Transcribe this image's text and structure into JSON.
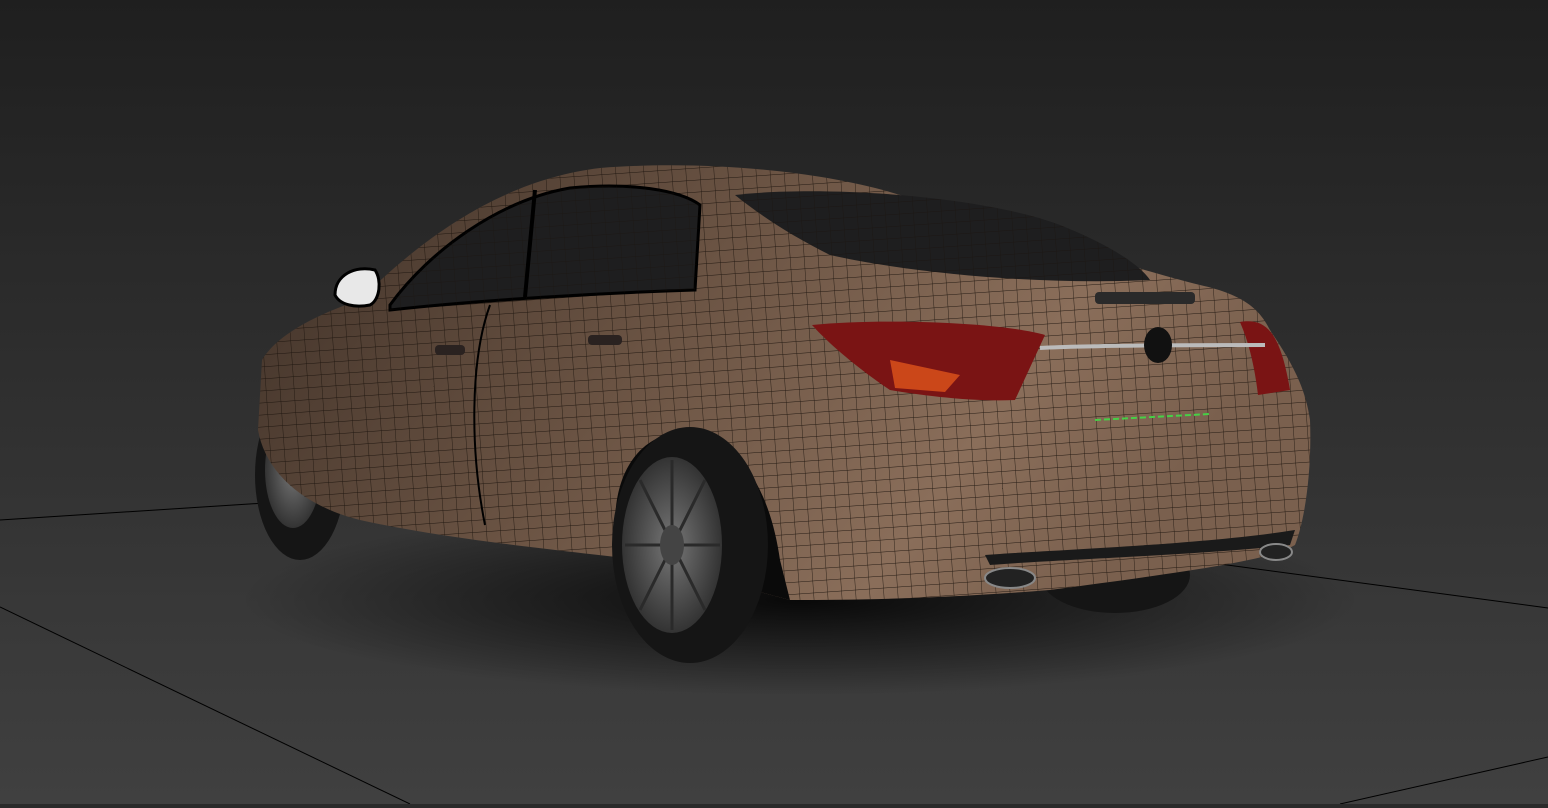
{
  "viewport": {
    "mode": "shaded-wireframe",
    "colors": {
      "background_top": "#1f1f1f",
      "background_bottom": "#404040",
      "ground_line": "#000000",
      "body_paint": "#6e5646",
      "body_highlight": "#8a6e5a",
      "wire": "#1a120c",
      "glass": "#1e1e1f",
      "tail_light": "#9a1a18",
      "tail_light_inner": "#e0541a",
      "mirror": "#e8e8e8",
      "tire": "#1a1a1a",
      "rim": "#5a5a5a",
      "selection_edge": "#46d046"
    }
  }
}
